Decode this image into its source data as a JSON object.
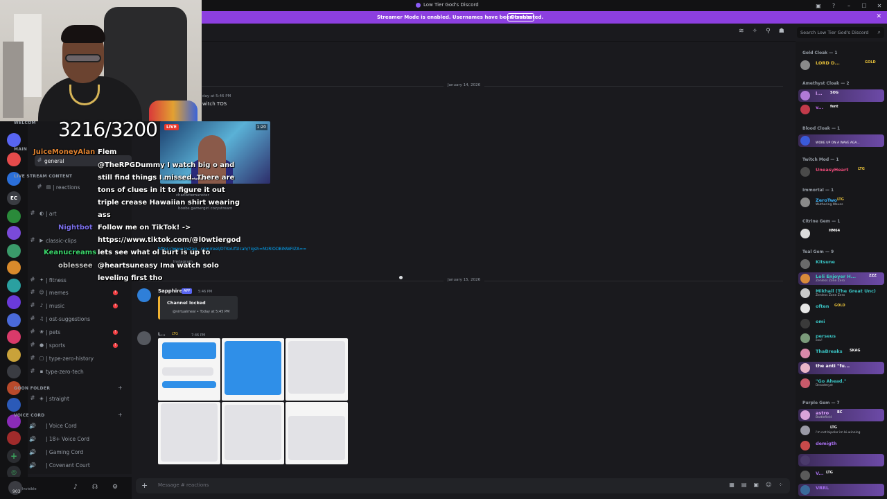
{
  "window": {
    "title": "Low Tier God's Discord",
    "controls": [
      "inbox",
      "help",
      "minimize",
      "maximize",
      "close"
    ]
  },
  "banner": {
    "text": "Streamer Mode is enabled. Usernames have been truncated.",
    "disable": "Disable"
  },
  "header": {
    "search_placeholder": "Search Low Tier God's Discord"
  },
  "sidebar": {
    "categories": {
      "welcome": "WELCOM",
      "main": "MAIN",
      "live": "LIVE STREAM CONTENT",
      "goon": "GOON FOLDER",
      "voice": "VOICE CORD"
    },
    "channels": [
      {
        "label": "general"
      },
      {
        "label": "| reactions"
      },
      {
        "label": "| art"
      },
      {
        "label": "classic-clips"
      },
      {
        "label": "| fitness"
      },
      {
        "label": "| memes"
      },
      {
        "label": "| music"
      },
      {
        "label": "| ost-suggestions"
      },
      {
        "label": "| pets"
      },
      {
        "label": "| sports"
      },
      {
        "label": "| type-zero-history"
      },
      {
        "label": "type-zero-tech"
      },
      {
        "label": "| straight"
      }
    ],
    "voice_channels": [
      {
        "label": "| Voice Cord"
      },
      {
        "label": "| 18+ Voice Cord"
      },
      {
        "label": "| Gaming Cord"
      },
      {
        "label": "| Covenant Court"
      }
    ],
    "server_icon_text": "EC"
  },
  "user": {
    "name": "903",
    "status": "Invisible"
  },
  "chat": {
    "top_fragment": {
      "time": "day at 5:46 PM",
      "text": "witch TOS"
    },
    "dividers": [
      "January 14, 2026",
      "January 15, 2026"
    ],
    "embed_caption": "charlottemunster",
    "embed_tags": "boobs   gamergirl   cozystream",
    "embed_title": "Hunter Rise Sunbrea...",
    "link_line": "https://www.instag...com/reel/DTKoUf1lcah/?igsh=MzRlODBiNWFIZA==",
    "instagram": "Instagram",
    "messages": [
      {
        "author": "Sapphire",
        "tag": "APP",
        "time": "5:46 PM",
        "embed_title": "Channel locked",
        "embed_sub": "@virtualmeal • Today at 5:45 PM"
      },
      {
        "author": "L...",
        "tag": "LTG",
        "time": "7:46 PM"
      }
    ],
    "composer_placeholder": "Message #  reactions"
  },
  "stream_overlay": {
    "sub_count": "3216/3200",
    "live_badge": "LIVE",
    "live_time": "1:20",
    "chat": [
      {
        "name": "JuiceMoneyAlan",
        "color": "#e0822f",
        "text": "Flem"
      },
      {
        "name": "",
        "color": "#ffffff",
        "text": "@TheRPGDummy I watch big o and"
      },
      {
        "name": "",
        "color": "#ffffff",
        "text": "still find things I missed. There are"
      },
      {
        "name": "",
        "color": "#ffffff",
        "text": "tons of clues in it to figure it out"
      },
      {
        "name": "",
        "color": "#ffffff",
        "text": "triple crease Hawaiian shirt wearing"
      },
      {
        "name": "",
        "color": "#ffffff",
        "text": "ass"
      },
      {
        "name": "Nightbot",
        "color": "#7a6ee8",
        "text": "Follow me on TikTok! ->"
      },
      {
        "name": "",
        "color": "#ffffff",
        "text": "https://www.tiktok.com/@l0wtiergod"
      },
      {
        "name": "Keanucreams",
        "color": "#3ad46a",
        "text": "lets see what ol burt is up to"
      },
      {
        "name": "oblessee",
        "color": "#c7c7c7",
        "text": "@heartsuneasy Ima watch solo"
      },
      {
        "name": "",
        "color": "#ffffff",
        "text": "leveling first tho"
      }
    ]
  },
  "members": {
    "roles": [
      {
        "name": "Gold Cloak — 1"
      },
      {
        "name": "Amethyst Cloak — 2"
      },
      {
        "name": "Blood Cloak — 1"
      },
      {
        "name": "Twitch Mod — 1"
      },
      {
        "name": "Immortal — 1"
      },
      {
        "name": "Citrine Gem — 1"
      },
      {
        "name": "Teal Gem — 9"
      },
      {
        "name": "Purple Gem — 7"
      }
    ],
    "people": [
      {
        "name": "LORD D...",
        "sub": "",
        "tag": "GOLD",
        "color": "#e8c13a"
      },
      {
        "name": "l...",
        "sub": "",
        "tag": "SOG",
        "color": "#c46cf0"
      },
      {
        "name": "v...",
        "sub": "",
        "tag": "fent",
        "color": "#c46cf0"
      },
      {
        "name": "",
        "sub": "WOKE UP ON A WAVE AGA...",
        "tag": "",
        "color": "#e0425a"
      },
      {
        "name": "UneasyHeart",
        "sub": "",
        "tag": "LTG",
        "color": "#ef4b7a"
      },
      {
        "name": "ZeroTwo",
        "sub": "Wuthering Waves",
        "tag": "LTG",
        "color": "#3ab0f5"
      },
      {
        "name": "",
        "sub": "",
        "tag": "HM64",
        "color": "#e3c14a"
      },
      {
        "name": "Kitsune",
        "sub": "",
        "tag": "",
        "color": "#3ac3c3"
      },
      {
        "name": "Loli Enjoyer H...",
        "sub": "Zenless Zone Zero",
        "tag": "ZZZ",
        "color": "#3ac3c3"
      },
      {
        "name": "Mikhail (The Great Unc)",
        "sub": "Zenless Zone Zero",
        "tag": "",
        "color": "#3ac3c3"
      },
      {
        "name": "often",
        "sub": "",
        "tag": "GOLD",
        "color": "#3ac3c3"
      },
      {
        "name": "omi",
        "sub": "",
        "tag": "",
        "color": "#3ac3c3"
      },
      {
        "name": "perseus",
        "sub": "osu!",
        "tag": "",
        "color": "#3ac3c3"
      },
      {
        "name": "ThaBreaks",
        "sub": "",
        "tag": "SKAG",
        "color": "#3ac3c3"
      },
      {
        "name": "the anti \"fu...",
        "sub": "",
        "tag": "",
        "color": "#3ac3c3"
      },
      {
        "name": "\"Go Ahead.\"",
        "sub": "Dreadmyst",
        "tag": "",
        "color": "#3ac3c3"
      },
      {
        "name": "astro",
        "sub": "Battlefield",
        "tag": "BC",
        "color": "#a970f0"
      },
      {
        "name": "",
        "sub": "i'm not bipolar im bi-winning",
        "tag": "LTG",
        "color": "#a970f0"
      },
      {
        "name": "demigth",
        "sub": "",
        "tag": "",
        "color": "#a970f0"
      },
      {
        "name": "",
        "sub": "",
        "tag": "",
        "color": "#a970f0"
      },
      {
        "name": "V...",
        "sub": "",
        "tag": "LTG",
        "color": "#a970f0"
      },
      {
        "name": "VRRL",
        "sub": "",
        "tag": "",
        "color": "#a970f0"
      }
    ]
  }
}
